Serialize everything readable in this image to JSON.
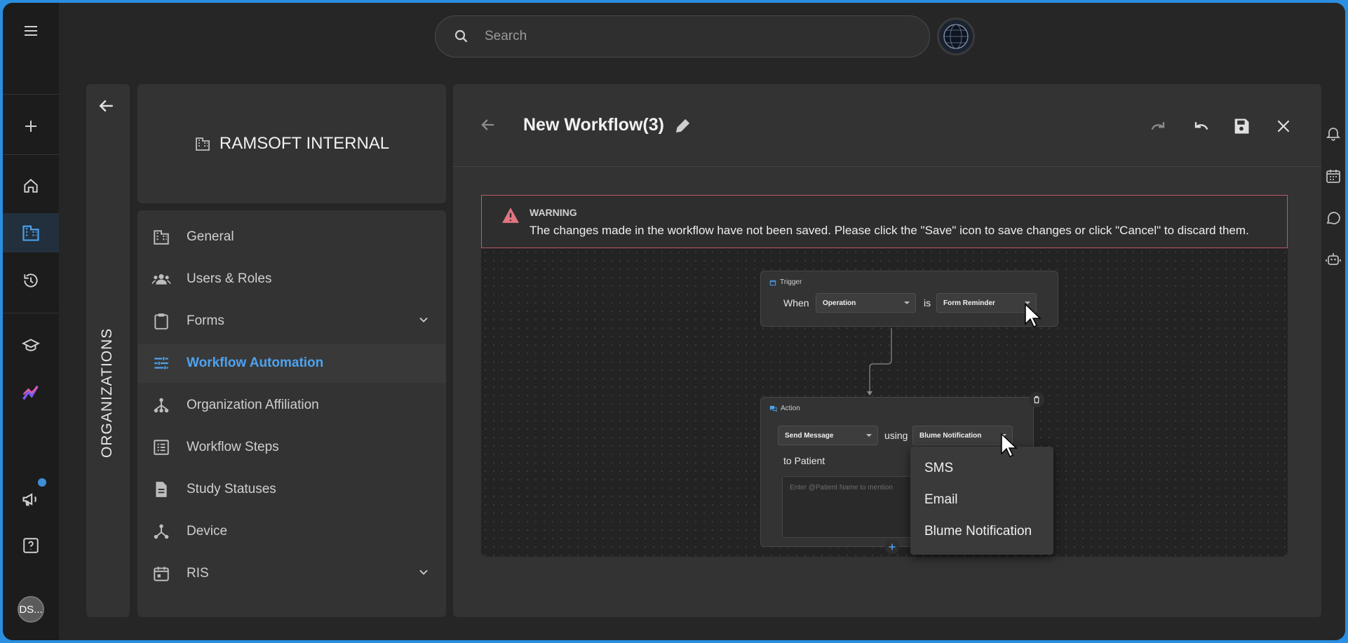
{
  "search": {
    "placeholder": "Search"
  },
  "org": {
    "side_label": "ORGANIZATIONS",
    "name": "RAMSOFT INTERNAL"
  },
  "menu": {
    "items": [
      {
        "label": "General",
        "icon": "building-icon"
      },
      {
        "label": "Users & Roles",
        "icon": "users-icon"
      },
      {
        "label": "Forms",
        "icon": "clipboard-icon",
        "expandable": true
      },
      {
        "label": "Workflow Automation",
        "icon": "sliders-icon",
        "active": true
      },
      {
        "label": "Organization Affiliation",
        "icon": "hierarchy-icon"
      },
      {
        "label": "Workflow Steps",
        "icon": "list-icon"
      },
      {
        "label": "Study Statuses",
        "icon": "document-icon"
      },
      {
        "label": "Device",
        "icon": "device-icon"
      },
      {
        "label": "RIS",
        "icon": "calendar-icon",
        "expandable": true
      }
    ]
  },
  "workflow": {
    "title": "New Workflow(3)",
    "warning": {
      "title": "WARNING",
      "text": "The changes made in the workflow have not been saved. Please click the \"Save\" icon to save changes or click \"Cancel\" to discard them."
    },
    "trigger": {
      "header": "Trigger",
      "when": "When",
      "field": "Operation",
      "is": "is",
      "value": "Form Reminder"
    },
    "action": {
      "header": "Action",
      "action_value": "Send Message",
      "using": "using",
      "channel": "Blume Notification",
      "to": "to Patient",
      "message_placeholder": "Enter @Patient Name to mention"
    },
    "channel_options": [
      "SMS",
      "Email",
      "Blume Notification"
    ]
  },
  "user": {
    "initials": "DS..."
  },
  "colors": {
    "accent": "#4da3f0",
    "warning_border": "#c05a68",
    "background": "#262626"
  }
}
